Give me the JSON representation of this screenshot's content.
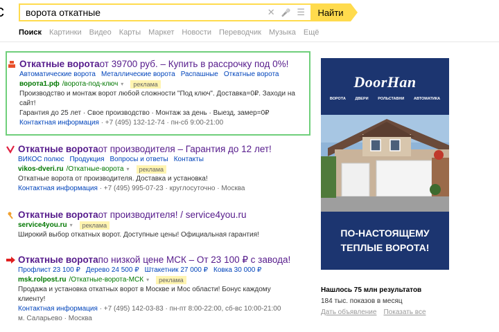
{
  "header": {
    "logo_char": "с",
    "search_query": "ворота откатные",
    "search_button": "Найти",
    "clear_glyph": "✕",
    "mic_glyph": "🎤",
    "settings_glyph": "☰"
  },
  "tabs": [
    "Поиск",
    "Картинки",
    "Видео",
    "Карты",
    "Маркет",
    "Новости",
    "Переводчик",
    "Музыка",
    "Ещё"
  ],
  "results": [
    {
      "title_bold": "Откатные ворота",
      "title_rest": " от 39700 руб. – Купить в рассрочку под 0%!",
      "sitelinks": [
        "Автоматические ворота",
        "Металлические ворота",
        "Распашные",
        "Откатные ворота"
      ],
      "url": "ворота1.рф",
      "url_rest": "/ворота-под-ключ",
      "ad": "реклама",
      "desc": "Производство и монтаж ворот любой сложности \"Под ключ\". Доставка=0₽. Заходи на сайт!",
      "extra": "Гарантия до 25 лет · Свое производство · Монтаж за день · Выезд, замер=0₽",
      "contact_link": "Контактная информация",
      "contact_rest": " · +7 (495) 132-12-74 · пн-сб 9:00-21:00"
    },
    {
      "title_bold": "Откатные ворота",
      "title_rest": " от производителя – Гарантия до 12 лет!",
      "sitelinks": [
        "ВИКОС полюс",
        "Продукция",
        "Вопросы и ответы",
        "Контакты"
      ],
      "url": "vikos-dveri.ru",
      "url_rest": "/Откатные-ворота",
      "ad": "реклама",
      "desc": "Откатные ворота от производителя. Доставка и установка!",
      "contact_link": "Контактная информация",
      "contact_rest": " · +7 (495) 995-07-23 · круглосуточно · Москва"
    },
    {
      "title_bold": "Откатные ворота",
      "title_rest": " от производителя! / service4you.ru",
      "url": "service4you.ru",
      "ad": "реклама",
      "desc": "Широкий выбор откатных ворот. Доступные цены! Официальная гарантия!"
    },
    {
      "title_bold": "Откатные ворота",
      "title_rest": " по низкой цене МСК – От 23 100 ₽ с завода!",
      "sitelinks": [
        "Профлист 23 100 ₽",
        "Дерево 24 500 ₽",
        "Штакетник 27 000 ₽",
        "Ковка 30 000 ₽"
      ],
      "url": "msk.rolpost.ru",
      "url_rest": "/Откатные-ворота-МСК",
      "ad": "реклама",
      "desc": "Продажа и установка откатных ворот в Москве и Мос области! Бонус каждому клиенту!",
      "contact_link": "Контактная информация",
      "contact_rest": " · +7 (495) 142-03-83 · пн-пт 8:00-22:00, сб-вс 10:00-21:00",
      "contact_extra": "м. Саларьево · Москва"
    }
  ],
  "banner": {
    "logo": "DoorHan",
    "menu": [
      "ВОРОТА",
      "ДВЕРИ",
      "РОЛЬСТАВНИ",
      "АВТОМАТИКА"
    ],
    "slogan_1": "ПО-НАСТОЯЩЕМУ",
    "slogan_2": "ТЕПЛЫЕ ВОРОТА!"
  },
  "stats": {
    "found": "Нашлось 75 млн результатов",
    "shows": "184 тыс. показов в месяц",
    "link_ad": "Дать объявление",
    "link_all": "Показать все"
  },
  "colors": {
    "accent": "#ffdb4d",
    "title": "#551a8b",
    "link": "#0044bb",
    "url": "#007700",
    "highlight_border": "#6fcf7a",
    "banner_bg": "#1c3570"
  }
}
